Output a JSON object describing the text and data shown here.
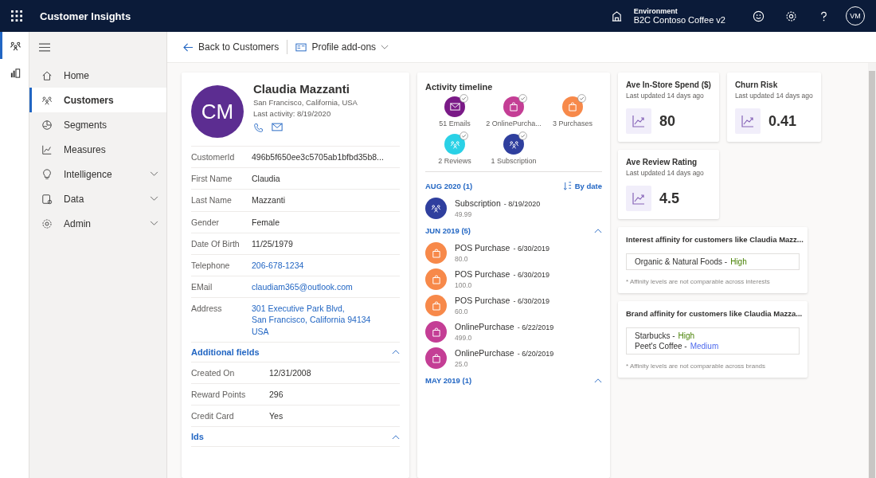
{
  "app_bar": {
    "title": "Customer Insights",
    "environment_label": "Environment",
    "environment": "B2C Contoso Coffee v2",
    "user_initials": "VM"
  },
  "rail": [
    {
      "selected": true
    },
    {
      "selected": false
    }
  ],
  "nav": [
    {
      "label": "Home",
      "selected": false,
      "has_menu": false
    },
    {
      "label": "Customers",
      "selected": true,
      "has_menu": false
    },
    {
      "label": "Segments",
      "selected": false,
      "has_menu": false
    },
    {
      "label": "Measures",
      "selected": false,
      "has_menu": false
    },
    {
      "label": "Intelligence",
      "selected": false,
      "has_menu": true
    },
    {
      "label": "Data",
      "selected": false,
      "has_menu": true
    },
    {
      "label": "Admin",
      "selected": false,
      "has_menu": true
    }
  ],
  "command_bar": {
    "back": "Back to Customers",
    "addons": "Profile add-ons"
  },
  "profile": {
    "initials": "CM",
    "name": "Claudia Mazzanti",
    "location": "San Francisco, California, USA",
    "last_activity": "Last activity: 8/19/2020",
    "fields": [
      {
        "label": "CustomerId",
        "value": "496b5f650ee3c5705ab1bfbd35b8...",
        "kind": "text"
      },
      {
        "label": "First Name",
        "value": "Claudia",
        "kind": "text"
      },
      {
        "label": "Last Name",
        "value": "Mazzanti",
        "kind": "text"
      },
      {
        "label": "Gender",
        "value": "Female",
        "kind": "text"
      },
      {
        "label": "Date Of Birth",
        "value": "11/25/1979",
        "kind": "text"
      },
      {
        "label": "Telephone",
        "value": "206-678-1234",
        "kind": "link"
      },
      {
        "label": "EMail",
        "value": "claudiam365@outlook.com",
        "kind": "link"
      },
      {
        "label": "Address",
        "value": "301 Executive Park Blvd,\nSan Francisco, California 94134\nUSA",
        "kind": "link"
      }
    ],
    "sections": [
      {
        "title": "Additional fields",
        "expanded": true,
        "fields": [
          {
            "label": "Created On",
            "value": "12/31/2008"
          },
          {
            "label": "Reward Points",
            "value": "296"
          },
          {
            "label": "Credit Card",
            "value": "Yes"
          }
        ]
      },
      {
        "title": "Ids",
        "expanded": true
      }
    ]
  },
  "timeline": {
    "title": "Activity timeline",
    "sort": "By date",
    "summary": [
      {
        "label": "51 Emails",
        "kind": "email",
        "selected": true
      },
      {
        "label": "2 OnlinePurcha...",
        "kind": "online",
        "selected": true
      },
      {
        "label": "3 Purchases",
        "kind": "pos",
        "selected": true
      },
      {
        "label": "2 Reviews",
        "kind": "review",
        "selected": true
      },
      {
        "label": "1 Subscription",
        "kind": "subscription",
        "selected": true
      }
    ],
    "groups": [
      {
        "title": "AUG 2020 (1)",
        "items": [
          {
            "title": "Subscription",
            "date": "- 8/19/2020",
            "amount": "49.99",
            "kind": "subscription"
          }
        ]
      },
      {
        "title": "JUN 2019 (5)",
        "items": [
          {
            "title": "POS Purchase",
            "date": "- 6/30/2019",
            "amount": "80.0",
            "kind": "pos"
          },
          {
            "title": "POS Purchase",
            "date": "- 6/30/2019",
            "amount": "100.0",
            "kind": "pos"
          },
          {
            "title": "POS Purchase",
            "date": "- 6/30/2019",
            "amount": "60.0",
            "kind": "pos"
          },
          {
            "title": "OnlinePurchase",
            "date": "- 6/22/2019",
            "amount": "499.0",
            "kind": "online"
          },
          {
            "title": "OnlinePurchase",
            "date": "- 6/20/2019",
            "amount": "25.0",
            "kind": "online"
          }
        ]
      },
      {
        "title": "MAY 2019 (1)"
      }
    ]
  },
  "measures": [
    {
      "title": "Ave In-Store Spend ($)",
      "updated": "Last updated 14 days ago",
      "value": "80"
    },
    {
      "title": "Churn Risk",
      "updated": "Last updated 14 days ago",
      "value": "0.41"
    },
    {
      "title": "Ave Review Rating",
      "updated": "Last updated 14 days ago",
      "value": "4.5"
    }
  ],
  "affinities": [
    {
      "title": "Interest affinity for customers like Claudia Mazz...",
      "note": "* Affinity levels are not comparable across interests",
      "items": [
        {
          "name": "Organic & Natural Foods -",
          "level": "High",
          "color": "#498205"
        }
      ]
    },
    {
      "title": "Brand affinity for customers like Claudia Mazza...",
      "note": "* Affinity levels are not comparable across brands",
      "items": [
        {
          "name": "Starbucks -",
          "level": "High",
          "color": "#498205"
        },
        {
          "name": "Peet's Coffee -",
          "level": "Medium",
          "color": "#4f6bed"
        }
      ]
    }
  ]
}
